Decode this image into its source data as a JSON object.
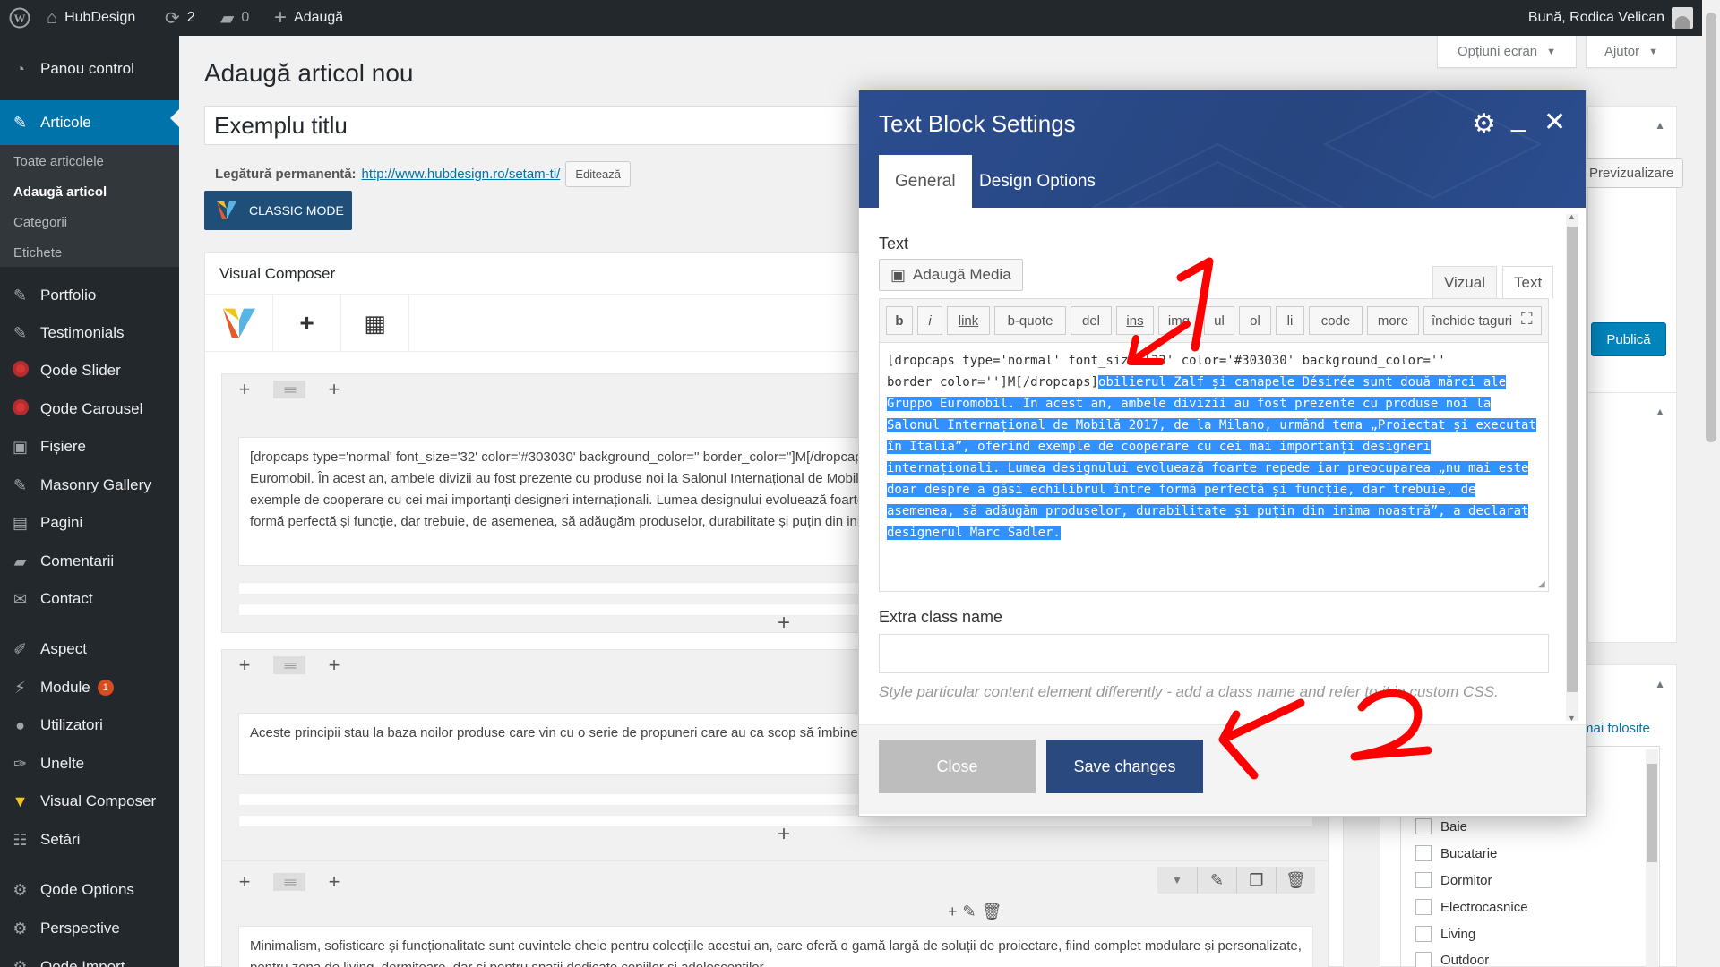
{
  "adminbar": {
    "site_name": "HubDesign",
    "updates_count": "2",
    "comments_count": "0",
    "add_new": "Adaugă",
    "greeting": "Bună, Rodica Velican"
  },
  "sidebar": {
    "items": [
      {
        "label": "Panou control"
      },
      {
        "label": "Articole"
      },
      {
        "label": "Portfolio"
      },
      {
        "label": "Testimonials"
      },
      {
        "label": "Qode Slider"
      },
      {
        "label": "Qode Carousel"
      },
      {
        "label": "Fișiere"
      },
      {
        "label": "Masonry Gallery"
      },
      {
        "label": "Pagini"
      },
      {
        "label": "Comentarii"
      },
      {
        "label": "Contact"
      },
      {
        "label": "Aspect"
      },
      {
        "label": "Module",
        "badge": "1"
      },
      {
        "label": "Utilizatori"
      },
      {
        "label": "Unelte"
      },
      {
        "label": "Visual Composer"
      },
      {
        "label": "Setări"
      },
      {
        "label": "Qode Options"
      },
      {
        "label": "Perspective"
      },
      {
        "label": "Qode Import"
      }
    ],
    "submenu": [
      "Toate articolele",
      "Adaugă articol",
      "Categorii",
      "Etichete"
    ]
  },
  "screen_meta": {
    "options": "Opțiuni ecran",
    "help": "Ajutor"
  },
  "page": {
    "title": "Adaugă articol nou",
    "post_title": "Exemplu titlu",
    "permalink_label": "Legătură permanentă:",
    "permalink_base": "http://www.hubdesign.ro/",
    "permalink_slug": "setam-ti/",
    "edit_button": "Editează",
    "classic_mode": "CLASSIC MODE"
  },
  "vc": {
    "header": "Visual Composer",
    "blocks": [
      "[dropcaps type='normal' font_size='32' color='#303030' background_color='' border_color='']M[/dropcaps]obilierul Zalf și canapele Désirée sunt două mărci ale Gruppo Euromobil. În acest an, ambele divizii au fost prezente cu produse noi la Salonul Internațional de Mobilă 2017, de la Milano, urmând tema „Proiectat și executat în Italia”, oferind exemple de cooperare cu cei mai importanți designeri internaționali. Lumea designului evoluează foarte repede iar preocuparea „nu mai este doar despre a găsi echilibrul între formă perfectă și funcție, dar trebuie, de asemenea, să adăugăm produselor, durabilitate și puțin din inima noastră”, a declarat designerul Marc Sadler.",
      "Aceste principii stau la baza noilor produse care vin cu o serie de propuneri care au ca scop să îmbine și designul, fără a trece peste stil și practic.",
      "Minimalism, sofisticare și funcționalitate sunt cuvintele cheie pentru colecțiile acestui an, care oferă o gamă largă de soluții de proiectare, fiind complet modulare și personalizate, pentru zona de living, dormitoare, dar și pentru spații dedicate copiilor și adolescentilor."
    ]
  },
  "right": {
    "preview": "Previzualizare",
    "publish": "Publică",
    "most_used_link": "Cele mai folosite",
    "categories": [
      "Baie",
      "Bucatarie",
      "Dormitor",
      "Electrocasnice",
      "Living",
      "Outdoor"
    ]
  },
  "modal": {
    "title": "Text Block Settings",
    "tabs": [
      "General",
      "Design Options"
    ],
    "text_label": "Text",
    "add_media": "Adaugă Media",
    "mode_visual": "Vizual",
    "mode_text": "Text",
    "quicktags": [
      "b",
      "i",
      "link",
      "b-quote",
      "del",
      "ins",
      "img",
      "ul",
      "ol",
      "li",
      "code",
      "more",
      "închide taguri"
    ],
    "editor_plain": "[dropcaps type='normal' font_size='32' color='#303030' background_color='' border_color='']M[/dropcaps]",
    "editor_selected": "obilierul Zalf și canapele Désirée sunt două mărci ale Gruppo Euromobil. În acest an, ambele divizii au fost prezente cu produse noi la Salonul Internațional de Mobilă 2017, de la Milano, urmând tema „Proiectat și executat în Italia”, oferind exemple de cooperare cu cei mai importanți designeri internaționali. Lumea designului evoluează foarte repede iar preocuparea „nu mai este doar despre a găsi echilibrul între formă perfectă și funcție, dar trebuie, de asemenea, să adăugăm produselor, durabilitate și puțin din inima noastră”, a declarat designerul Marc Sadler.",
    "extra_class_label": "Extra class name",
    "extra_class_value": "",
    "extra_class_help": "Style particular content element differently - add a class name and refer to it in custom CSS.",
    "close": "Close",
    "save": "Save changes"
  },
  "annotations": {
    "label_1": "1",
    "label_2": "2",
    "color": "#ff0000"
  },
  "colors": {
    "admin_dark": "#23282d",
    "wp_blue": "#0073aa",
    "modal_header": "#2b4d8f",
    "save_button": "#2a4a7f",
    "close_button": "#bdbdbd",
    "selection": "#3390ff"
  }
}
